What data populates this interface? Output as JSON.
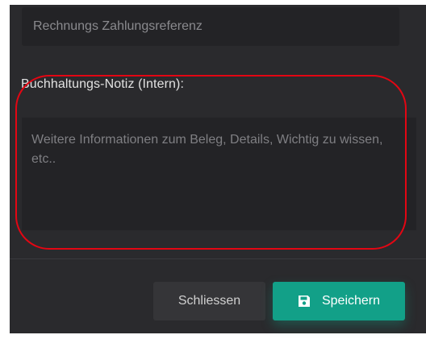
{
  "payment_reference": {
    "placeholder": "Rechnungs Zahlungsreferenz",
    "value": ""
  },
  "accounting_note": {
    "label": "Buchhaltungs-Notiz (Intern):",
    "placeholder": "Weitere Informationen zum Beleg, Details, Wichtig zu wissen, etc..",
    "value": ""
  },
  "footer": {
    "close_label": "Schliessen",
    "save_label": "Speichern",
    "save_icon": "floppy-disk-icon"
  },
  "colors": {
    "accent": "#12a088",
    "highlight": "#e30613",
    "panel_background": "#2a2a2d"
  }
}
